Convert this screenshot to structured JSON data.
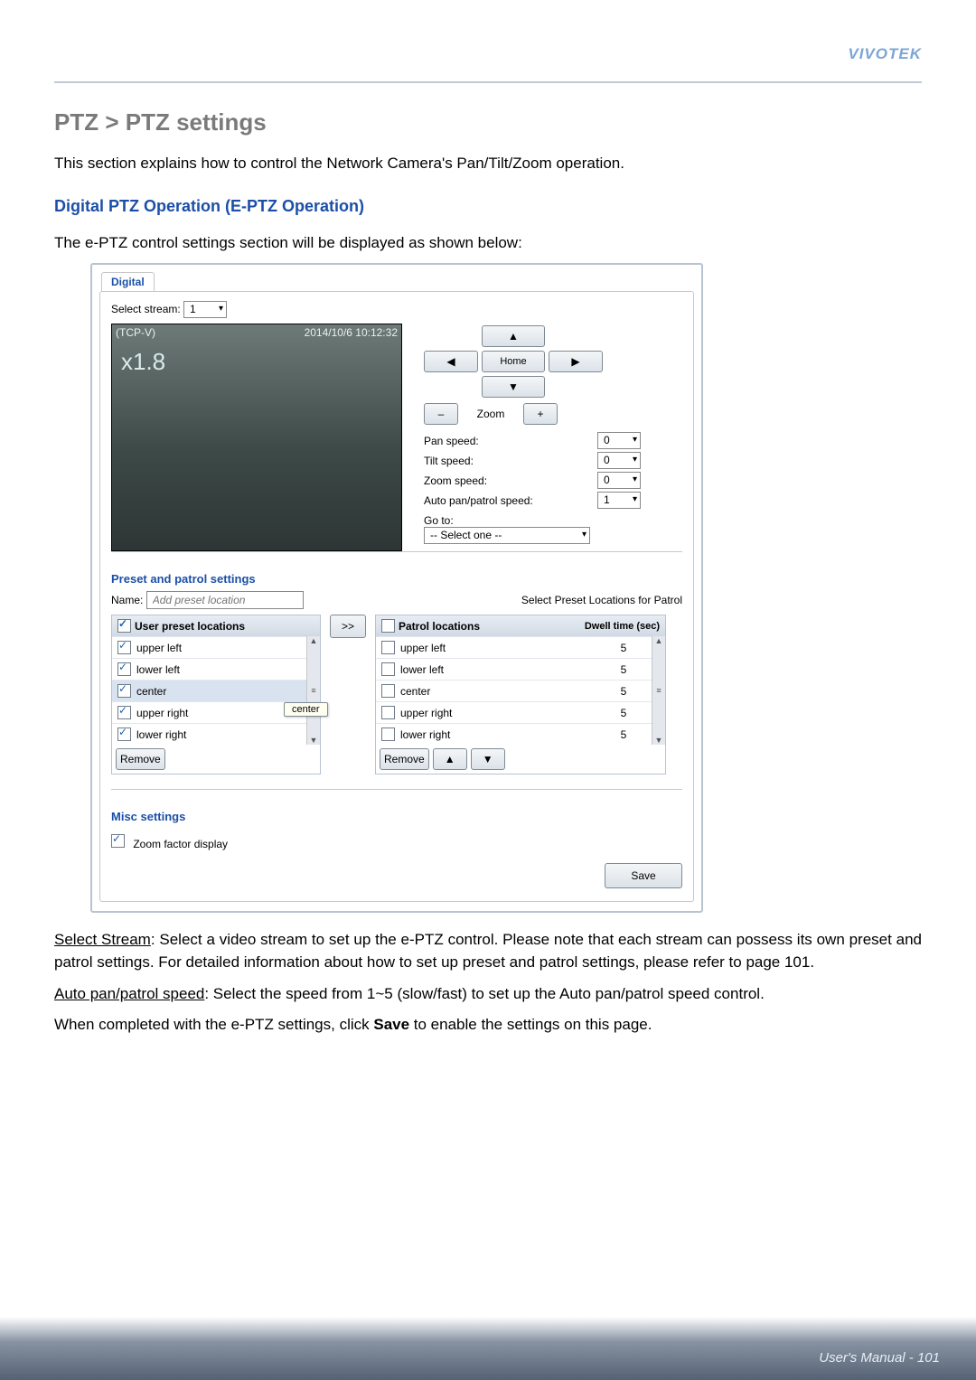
{
  "brand": "VIVOTEK",
  "page_title": "PTZ > PTZ settings",
  "intro": "This section explains how to control the Network Camera's Pan/Tilt/Zoom operation.",
  "sub_heading": "Digital PTZ Operation (E-PTZ Operation)",
  "sub_intro": "The e-PTZ control settings section will be displayed as shown below:",
  "ui": {
    "tab": "Digital",
    "select_stream_label": "Select stream:",
    "select_stream_value": "1",
    "video": {
      "conn": "(TCP-V)",
      "timestamp": "2014/10/6 10:12:32",
      "zoom_factor": "x1.8"
    },
    "controls": {
      "home": "Home",
      "zoom_label": "Zoom",
      "pan_speed_label": "Pan speed:",
      "tilt_speed_label": "Tilt speed:",
      "zoom_speed_label": "Zoom speed:",
      "auto_speed_label": "Auto pan/patrol speed:",
      "pan_speed": "0",
      "tilt_speed": "0",
      "zoom_speed": "0",
      "auto_speed": "1",
      "goto_label": "Go to:",
      "goto_value": "-- Select one --"
    },
    "preset_section": "Preset and patrol settings",
    "name_label": "Name:",
    "name_placeholder": "Add preset location",
    "select_patrol_label": "Select Preset Locations for Patrol",
    "user_preset_header": "User preset locations",
    "patrol_header": "Patrol locations",
    "dwell_header": "Dwell time (sec)",
    "preset_items": [
      {
        "label": "upper left",
        "checked": true
      },
      {
        "label": "lower left",
        "checked": true
      },
      {
        "label": "center",
        "checked": true
      },
      {
        "label": "upper right",
        "checked": true
      },
      {
        "label": "lower right",
        "checked": true
      }
    ],
    "patrol_items": [
      {
        "label": "upper left",
        "dwell": "5"
      },
      {
        "label": "lower left",
        "dwell": "5"
      },
      {
        "label": "center",
        "dwell": "5"
      },
      {
        "label": "upper right",
        "dwell": "5"
      },
      {
        "label": "lower right",
        "dwell": "5"
      }
    ],
    "tooltip": "center",
    "move_btn": ">>",
    "remove": "Remove",
    "misc_section": "Misc settings",
    "zoom_factor_display": "Zoom factor display",
    "save": "Save"
  },
  "para1_lead": "Select Stream",
  "para1_rest": ": Select a video stream to set up the e-PTZ control. Please note that each stream can possess its own preset and patrol settings. For detailed information about how to set up preset and patrol settings, please refer to page 101.",
  "para2_lead": "Auto pan/patrol speed",
  "para2_rest": ": Select the speed from 1~5 (slow/fast) to set up the Auto pan/patrol speed control.",
  "para3_a": "When completed with the e-PTZ settings, click ",
  "para3_b": "Save",
  "para3_c": " to enable the settings on this page.",
  "footer_label": "User's Manual - ",
  "footer_page": "101"
}
